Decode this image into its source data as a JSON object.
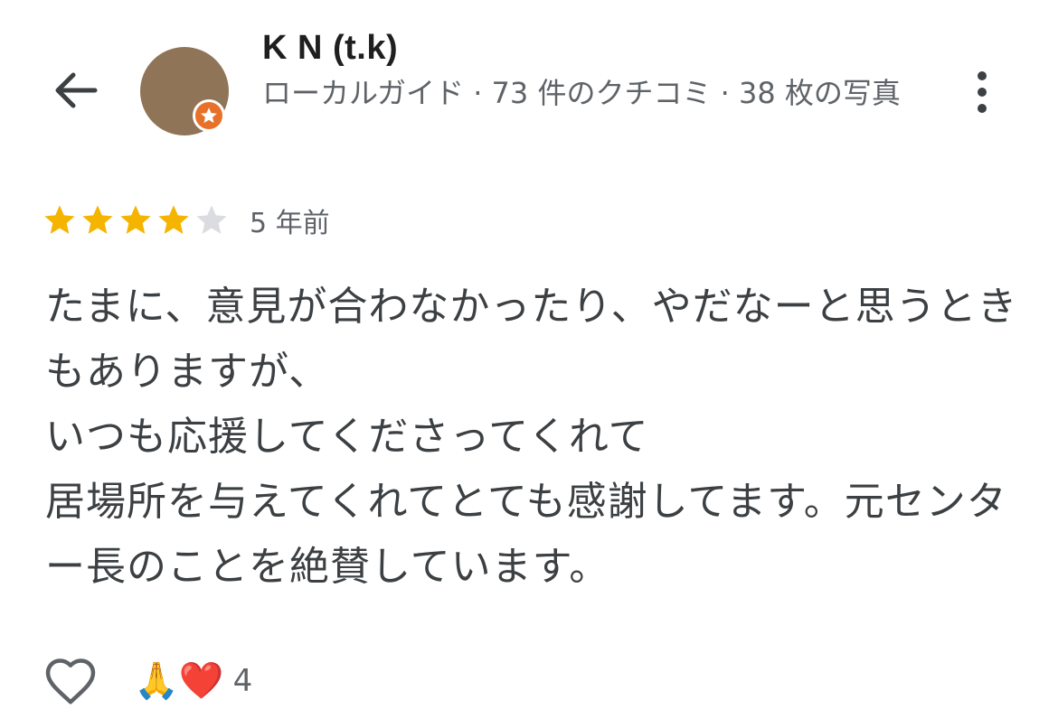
{
  "header": {
    "back_icon": "arrow-back-icon",
    "user_name": "K N (t.k)",
    "user_meta": "ローカルガイド · 73 件のクチコミ · 38 枚の写真",
    "avatar_color": "#8f7458",
    "badge_icon": "local-guide-star-icon",
    "badge_color": "#e8712a",
    "more_icon": "more-vertical-icon"
  },
  "rating": {
    "value": 4,
    "max": 5,
    "filled_color": "#f4b400",
    "empty_color": "#dadce0",
    "time": "5 年前"
  },
  "review": {
    "text": "たまに、意見が合わなかったり、やだなーと思うときもありますが、\nいつも応援してくださってくれて\n居場所を与えてくれてとても感謝してます。元センター長のことを絶賛しています。"
  },
  "actions": {
    "like_icon": "heart-outline-icon",
    "reaction_emojis": "🙏❤️",
    "reaction_count": "4"
  }
}
